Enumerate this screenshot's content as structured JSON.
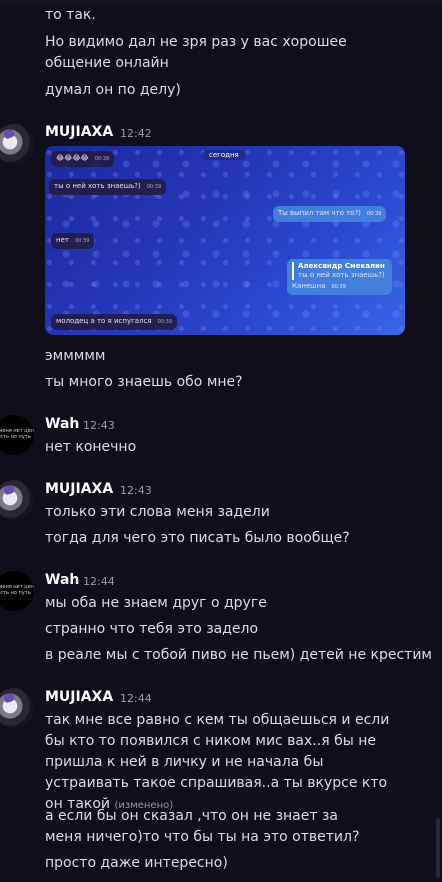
{
  "messages_top": [
    "то так.",
    "Но видимо дал не зря раз у вас хорошее общение онлайн",
    "думал он по делу)"
  ],
  "groups": [
    {
      "author": "MUJIAXA",
      "time": "12:42",
      "screenshot": {
        "date_pill": "сегодня",
        "bubbles": [
          {
            "text": "😂😂😂😂",
            "time": "00:38"
          },
          {
            "text": "ты о ней хоть знаешь?)",
            "time": "00:39"
          },
          {
            "text": "Ты выпил там что то?)",
            "time": "00:39"
          },
          {
            "text": "нет",
            "time": "00:39"
          },
          {
            "reply_name": "Александр Смекалин",
            "reply_text": "ты о ней хоть знаешь?)",
            "text": "Канешна",
            "time": "00:39"
          },
          {
            "text": "молодец а то я испугался",
            "time": "00:39"
          }
        ]
      },
      "lines": [
        "эммммм",
        "ты много знаешь обо мне?"
      ]
    },
    {
      "author": "Wah",
      "time": "12:43",
      "avatar_text": "у меня нет цел\nесть но путь",
      "lines": [
        "нет конечно"
      ]
    },
    {
      "author": "MUJIAXA",
      "time": "12:43",
      "lines": [
        "только эти слова меня задели",
        "тогда для чего это писать было вообще?"
      ]
    },
    {
      "author": "Wah",
      "time": "12:44",
      "avatar_text": "у меня нет цел\nесть но путь",
      "lines": [
        "мы оба не знаем друг о друге",
        "странно что тебя это задело",
        "в реале мы с тобой пиво не пьем) детей не крестим"
      ]
    },
    {
      "author": "MUJIAXA",
      "time": "12:44",
      "lines": [
        "так мне все равно с кем ты общаешься и если бы кто то появился с ником мис вах..я бы не пришла к ней в личку и не начала бы устраивать такое спрашивая..а ты вкурсе кто он такой",
        "а если бы он сказал ,что он не знает за меня ничего)то что бы ты на это ответил?",
        "просто даже интересно)"
      ],
      "edited_label": "(изменено)"
    }
  ]
}
